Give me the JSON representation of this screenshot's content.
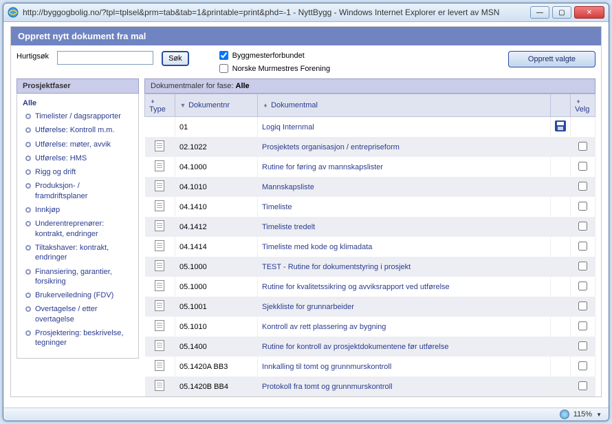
{
  "window": {
    "title": "http://byggogbolig.no/?tpl=tplsel&prm=tab&tab=1&printable=print&phd=-1 - NyttBygg - Windows Internet Explorer er levert av MSN"
  },
  "page": {
    "heading": "Opprett nytt dokument fra mal",
    "search_label": "Hurtigsøk",
    "search_button": "Søk",
    "filter1_label": "Byggmesterforbundet",
    "filter2_label": "Norske Murmestres Forening",
    "create_button": "Opprett valgte"
  },
  "sidebar": {
    "title": "Prosjektfaser",
    "all": "Alle",
    "items": [
      "Timelister / dagsrapporter",
      "Utførelse: Kontroll m.m.",
      "Utførelse: møter, avvik",
      "Utførelse: HMS",
      "Rigg og drift",
      "Produksjon- / framdriftsplaner",
      "Innkjøp",
      "Underentreprenører: kontrakt, endringer",
      "Tiltakshaver: kontrakt, endringer",
      "Finansiering, garantier, forsikring",
      "Brukerveiledning (FDV)",
      "Overtagelse / etter overtagelse",
      "Prosjektering: beskrivelse, tegninger"
    ]
  },
  "table": {
    "title_prefix": "Dokumentmaler for fase: ",
    "title_value": "Alle",
    "cols": {
      "type": "Type",
      "nr": "Dokumentnr",
      "mal": "Dokumentmal",
      "velg": "Velg"
    },
    "rows": [
      {
        "nr": "01",
        "mal": "Logiq Internmal",
        "icon": false,
        "save": true,
        "checkbox": false
      },
      {
        "nr": "02.1022",
        "mal": "Prosjektets organisasjon / entrepriseform",
        "icon": true,
        "save": false,
        "checkbox": true
      },
      {
        "nr": "04.1000",
        "mal": "Rutine for føring av mannskapslister",
        "icon": true,
        "save": false,
        "checkbox": true
      },
      {
        "nr": "04.1010",
        "mal": "Mannskapsliste",
        "icon": true,
        "save": false,
        "checkbox": true
      },
      {
        "nr": "04.1410",
        "mal": "Timeliste",
        "icon": true,
        "save": false,
        "checkbox": true
      },
      {
        "nr": "04.1412",
        "mal": "Timeliste tredelt",
        "icon": true,
        "save": false,
        "checkbox": true
      },
      {
        "nr": "04.1414",
        "mal": "Timeliste med kode og klimadata",
        "icon": true,
        "save": false,
        "checkbox": true
      },
      {
        "nr": "05.1000",
        "mal": "TEST - Rutine for dokumentstyring i prosjekt",
        "icon": true,
        "save": false,
        "checkbox": true
      },
      {
        "nr": "05.1000",
        "mal": "Rutine for kvalitetssikring og avviksrapport ved utførelse",
        "icon": true,
        "save": false,
        "checkbox": true
      },
      {
        "nr": "05.1001",
        "mal": "Sjekkliste for grunnarbeider",
        "icon": true,
        "save": false,
        "checkbox": true
      },
      {
        "nr": "05.1010",
        "mal": "Kontroll av rett plassering av bygning",
        "icon": true,
        "save": false,
        "checkbox": true
      },
      {
        "nr": "05.1400",
        "mal": "Rutine for kontroll av prosjektdokumentene før utførelse",
        "icon": true,
        "save": false,
        "checkbox": true
      },
      {
        "nr": "05.1420A BB3",
        "mal": "Innkalling til tomt og grunnmurskontroll",
        "icon": true,
        "save": false,
        "checkbox": true
      },
      {
        "nr": "05.1420B BB4",
        "mal": "Protokoll fra tomt og grunnmurskontroll",
        "icon": true,
        "save": false,
        "checkbox": true
      }
    ]
  },
  "status": {
    "zoom": "115%"
  }
}
